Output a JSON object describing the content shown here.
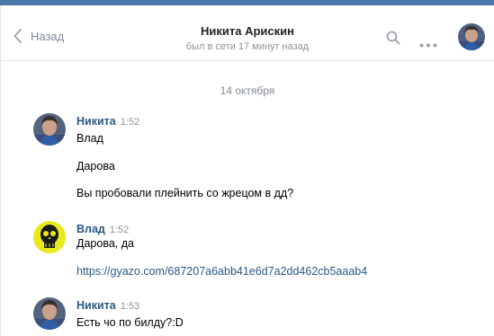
{
  "header": {
    "back_label": "Назад",
    "peer_name": "Никита Арискин",
    "peer_status": "был в сети 17 минут назад"
  },
  "date_separator": "14 октября",
  "messages": [
    {
      "author": "Никита",
      "time": "1:52",
      "lines": [
        "Влад",
        "Дарова",
        "Вы пробовали плейнить со жрецом в дд?"
      ]
    },
    {
      "author": "Влад",
      "time": "1:52",
      "lines": [
        "Дарова, да",
        "https://gyazo.com/687207a6abb41e6d7a2dd462cb5aaab4"
      ]
    },
    {
      "author": "Никита",
      "time": "1:53",
      "lines": [
        "Есть чо по билду?:D"
      ]
    }
  ],
  "icons": [
    "chevron-left-icon",
    "search-icon",
    "more-icon"
  ],
  "colors": {
    "accent": "#4a76a8",
    "author_link": "#2a5885",
    "muted": "#828a99",
    "background": "#edeef0"
  }
}
